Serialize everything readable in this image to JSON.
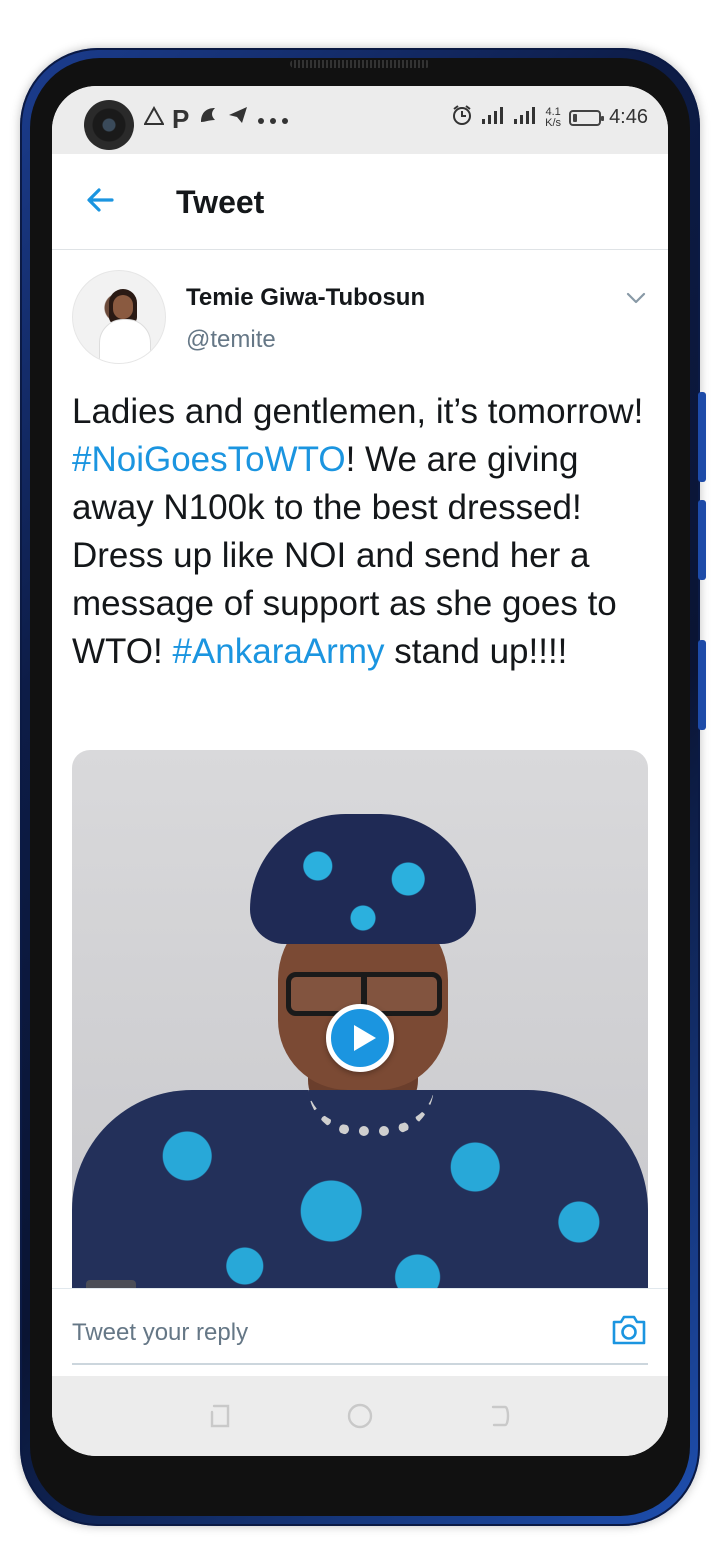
{
  "status_bar": {
    "time": "4:46",
    "network_speed": "4.1",
    "network_speed_unit": "K/s",
    "network_type": "4G",
    "battery_level": 0.15,
    "icons": [
      "warning-icon",
      "p-icon",
      "app-icon",
      "telegram-icon",
      "more-dots-icon",
      "alarm-icon",
      "signal-icon",
      "signal-4g-icon",
      "battery-icon"
    ]
  },
  "header": {
    "title": "Tweet",
    "back_icon": "arrow-left-icon"
  },
  "tweet": {
    "author_name": "Temie Giwa-Tubosun",
    "author_handle": "@temite",
    "text_parts": [
      "Ladies and gentlemen, it’s tomorrow! ",
      "#NoiGoesToWTO",
      "! We are giving away N100k to the best dressed! Dress up like NOI and send her a message of support as she goes to WTO! ",
      "#AnkaraArmy",
      " stand up!!!!"
    ],
    "media_type": "video"
  },
  "reply": {
    "placeholder": "Tweet your reply"
  },
  "colors": {
    "accent": "#1b95e0",
    "text": "#14171a",
    "secondary_text": "#657786",
    "status_bar_bg": "#ececec"
  }
}
